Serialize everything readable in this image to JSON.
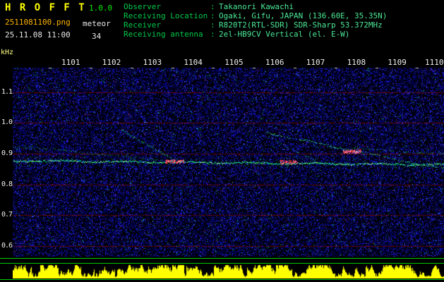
{
  "app": {
    "title": "H R O F F T",
    "version": "1.0.0",
    "filename": "2511081100.png",
    "mode": "meteor",
    "datetime": "25.11.08 11:00",
    "count": "34"
  },
  "info": {
    "rows": [
      {
        "label": "Observer",
        "value": "Takanori Kawachi"
      },
      {
        "label": "Receiving Location",
        "value": "Ogaki, Gifu, JAPAN (136.60E, 35.35N)"
      },
      {
        "label": "Receiver",
        "value": "R820T2(RTL-SDR) SDR-Sharp 53.372MHz"
      },
      {
        "label": "Receiving antenna",
        "value": "2el-HB9CV Vertical (el. E-W)"
      }
    ]
  },
  "colors": {
    "title": "#ffff00",
    "version_text": "#00ee00",
    "filename_text": "#ffb400",
    "header_label": "#00c84a",
    "header_value": "#4ce896",
    "axis_text": "#f0f0f0",
    "khz_label": "#ffff80",
    "separator": "#00cc00",
    "signal_strip": "#ffff00",
    "grid_line": "#5c0606"
  },
  "chart_data": {
    "type": "heatmap",
    "title": "",
    "x_axis": {
      "tick_labels": [
        "1101",
        "1102",
        "1103",
        "1104",
        "1105",
        "1106",
        "1107",
        "1108",
        "1109",
        "1110"
      ]
    },
    "y_axis": {
      "label": "kHz",
      "tick_labels": [
        "1.1",
        "1.0",
        "0.9",
        "0.8",
        "0.7",
        "0.6"
      ],
      "tick_values_khz": [
        1.1,
        1.0,
        0.9,
        0.8,
        0.7,
        0.6
      ],
      "range_khz": [
        0.565,
        1.18
      ]
    },
    "grid_lines_khz": [
      1.1,
      1.0,
      0.9,
      0.8,
      0.7,
      0.6
    ],
    "carrier_trace": {
      "name": "direct-carrier",
      "intensity": "strong",
      "points_minute_khz": [
        [
          1099.6,
          0.877
        ],
        [
          1110.4,
          0.863
        ]
      ]
    },
    "doppler_traces": [
      {
        "name": "airplane-echo-1",
        "intensity": "faint",
        "points_minute_khz": [
          [
            1099.6,
            0.925
          ],
          [
            1103.5,
            0.876
          ]
        ]
      },
      {
        "name": "airplane-echo-2",
        "intensity": "medium",
        "points_minute_khz": [
          [
            1102.25,
            0.978
          ],
          [
            1103.6,
            0.873
          ]
        ]
      },
      {
        "name": "airplane-echo-3",
        "intensity": "medium",
        "points_minute_khz": [
          [
            1105.8,
            0.968
          ],
          [
            1110.4,
            0.843
          ]
        ]
      },
      {
        "name": "airplane-echo-4",
        "intensity": "faint",
        "points_minute_khz": [
          [
            1105.85,
            0.955
          ],
          [
            1106.95,
            0.878
          ]
        ]
      },
      {
        "name": "airplane-echo-5",
        "intensity": "faint",
        "points_minute_khz": [
          [
            1107.3,
            0.922
          ],
          [
            1110.4,
            0.896
          ]
        ]
      }
    ],
    "echo_hotspots_minute_khz": [
      [
        1103.55,
        0.874
      ],
      [
        1106.35,
        0.872
      ],
      [
        1107.9,
        0.907
      ]
    ],
    "noise": {
      "background": "#000008",
      "palette": [
        "#00006e",
        "#0000a0",
        "#1414c8",
        "#2828e6",
        "#4646ff",
        "#00c8c8",
        "#00c853",
        "#c81e3c"
      ]
    },
    "grid_color": "#5c0606",
    "signal_strip_color": "#ffff00"
  }
}
